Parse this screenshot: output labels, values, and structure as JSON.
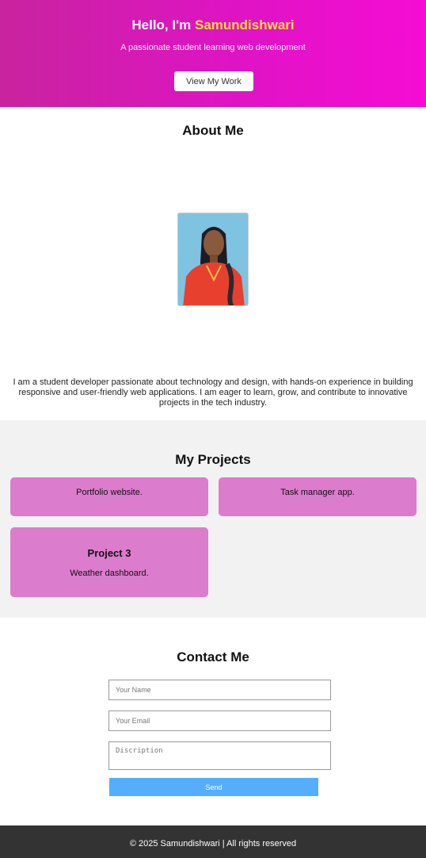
{
  "hero": {
    "greeting": "Hello, I'm ",
    "name": "Samundishwari",
    "subtitle": "A passionate student learning web development",
    "button_label": "View My Work"
  },
  "about": {
    "title": "About Me",
    "text": "I am a student developer passionate about technology and design, with hands-on experience in building responsive and user-friendly web applications. I am eager to learn, grow, and contribute to innovative projects in the tech industry."
  },
  "projects": {
    "title": "My Projects",
    "items": [
      {
        "title": "",
        "description": "Portfolio website."
      },
      {
        "title": "",
        "description": "Task manager app."
      },
      {
        "title": "Project 3",
        "description": "Weather dashboard."
      }
    ]
  },
  "contact": {
    "title": "Contact Me",
    "name_placeholder": "Your Name",
    "email_placeholder": "Your Email",
    "description_placeholder": "Discription",
    "send_label": "Send"
  },
  "footer": {
    "text": "© 2025 Samundishwari | All rights reserved"
  },
  "colors": {
    "hero_gradient_start": "#c8249e",
    "hero_gradient_end": "#f60cd4",
    "name_highlight": "#ffe033",
    "card_bg": "#dc7ccc",
    "send_button": "#55aefc",
    "footer_bg": "#333333"
  }
}
